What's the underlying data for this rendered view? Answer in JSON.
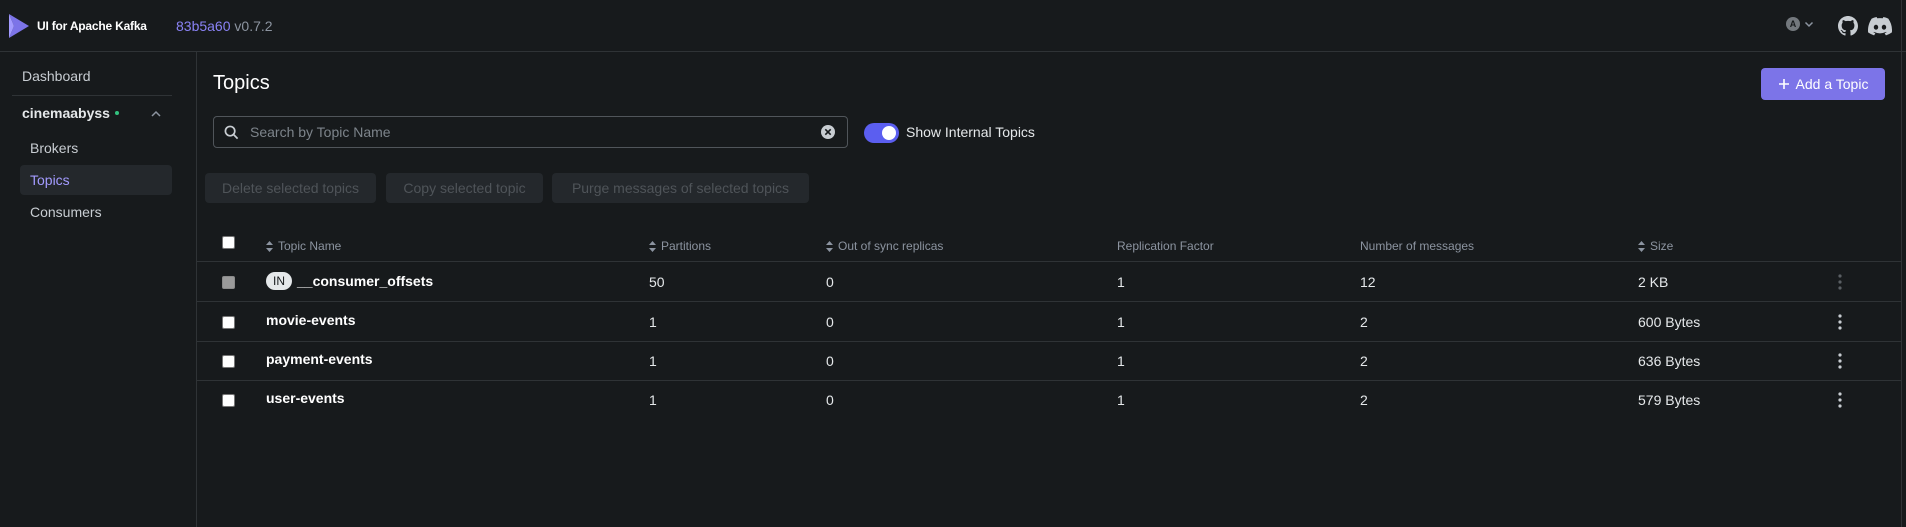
{
  "app": {
    "title": "UI for Apache Kafka",
    "commit": "83b5a60",
    "version": "v0.7.2",
    "theme_badge": "A"
  },
  "colors": {
    "accent": "#7c74e8",
    "active_nav": "#a39bff",
    "toggle_on": "#5b5ef0",
    "cluster_online": "#33c27f"
  },
  "sidebar": {
    "dashboard": "Dashboard",
    "cluster": "cinemaabyss",
    "items": [
      {
        "label": "Brokers"
      },
      {
        "label": "Topics"
      },
      {
        "label": "Consumers"
      }
    ],
    "active": "Topics"
  },
  "page": {
    "title": "Topics",
    "add_button": "Add a Topic",
    "search_placeholder": "Search by Topic Name",
    "show_internal_label": "Show Internal Topics",
    "show_internal": true
  },
  "bulk_actions": [
    "Delete selected topics",
    "Copy selected topic",
    "Purge messages of selected topics"
  ],
  "table": {
    "columns": [
      "Topic Name",
      "Partitions",
      "Out of sync replicas",
      "Replication Factor",
      "Number of messages",
      "Size"
    ],
    "internal_badge": "IN",
    "rows": [
      {
        "name": "__consumer_offsets",
        "internal": true,
        "partitions": "50",
        "out_of_sync": "0",
        "replication": "1",
        "messages": "12",
        "size": "2 KB"
      },
      {
        "name": "movie-events",
        "internal": false,
        "partitions": "1",
        "out_of_sync": "0",
        "replication": "1",
        "messages": "2",
        "size": "600 Bytes"
      },
      {
        "name": "payment-events",
        "internal": false,
        "partitions": "1",
        "out_of_sync": "0",
        "replication": "1",
        "messages": "2",
        "size": "636 Bytes"
      },
      {
        "name": "user-events",
        "internal": false,
        "partitions": "1",
        "out_of_sync": "0",
        "replication": "1",
        "messages": "2",
        "size": "579 Bytes"
      }
    ]
  }
}
